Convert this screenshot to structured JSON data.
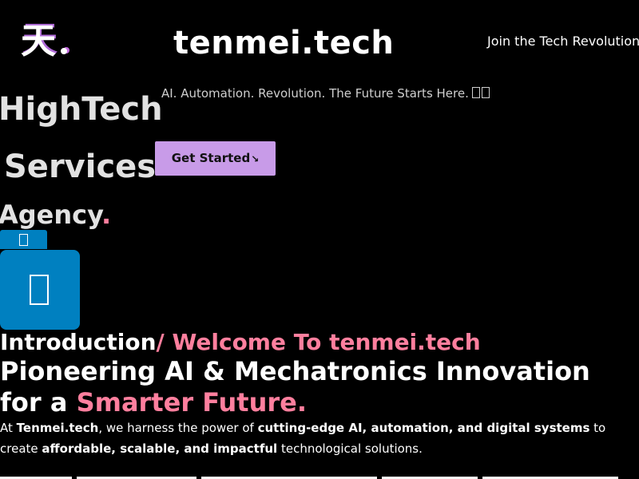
{
  "header": {
    "logo": {
      "glyph": "天",
      "icon": "tenmei-logo-icon"
    },
    "title": "tenmei.tech",
    "join_link": "Join the Tech Revolution"
  },
  "hero": {
    "tagline": "AI. Automation. Revolution. The Future Starts Here.",
    "words": [
      "HighTech",
      "Services",
      "Agency"
    ],
    "accent_dot": ".",
    "cta_label": "Get Started",
    "cta_arrow_icon": "arrow-icon"
  },
  "intro": {
    "label": "Introduction",
    "welcome": "/ Welcome To tenmei.tech",
    "headline_main": "Pioneering AI & Mechatronics Innovation for a ",
    "headline_accent": "Smarter Future.",
    "para": {
      "p1": "At ",
      "b1": "Tenmei.tech",
      "p2": ", we harness the power of ",
      "b2": "cutting-edge AI, automation, and digital systems",
      "p3": " to create ",
      "b3": "affordable, scalable, and impactful",
      "p4": " technological solutions."
    }
  },
  "colors": {
    "background": "#000000",
    "accent_pink": "#ff7f9e",
    "button_purple": "#c89be8",
    "widget_blue": "#0080c0"
  },
  "icons": {
    "tagline_emoji": "robot-rocket-emoji-icon",
    "blue_tab": "chat-tab-icon",
    "blue_box": "chat-widget-icon"
  }
}
